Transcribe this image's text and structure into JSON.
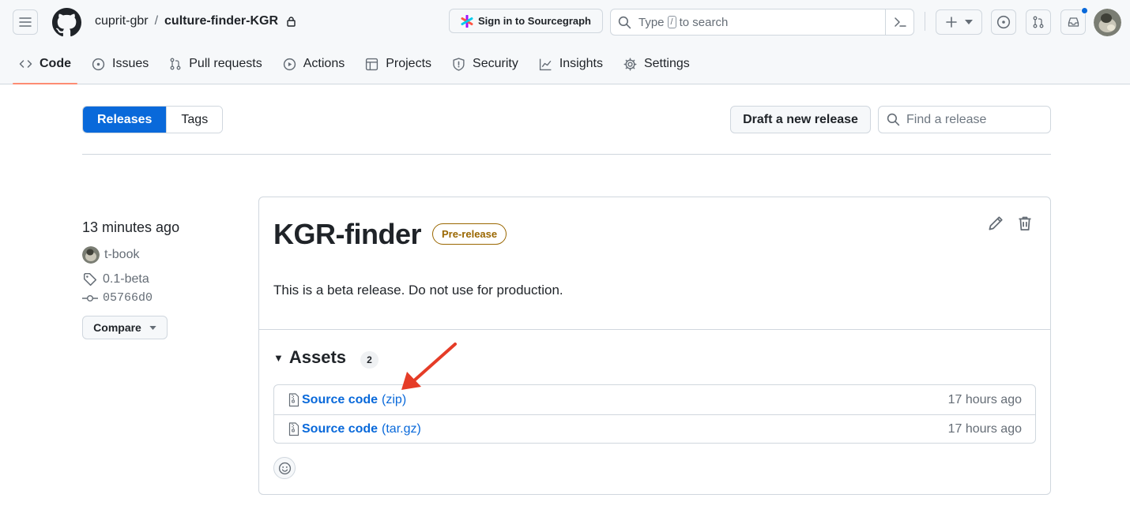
{
  "header": {
    "owner": "cuprit-gbr",
    "separator": "/",
    "repo": "culture-finder-KGR",
    "sourcegraph_label": "Sign in to Sourcegraph",
    "search_prefix": "Type",
    "search_key": "/",
    "search_suffix": "to search"
  },
  "tabs": [
    {
      "label": "Code",
      "icon": "code-icon"
    },
    {
      "label": "Issues",
      "icon": "issue-icon"
    },
    {
      "label": "Pull requests",
      "icon": "pull-request-icon"
    },
    {
      "label": "Actions",
      "icon": "play-icon"
    },
    {
      "label": "Projects",
      "icon": "table-icon"
    },
    {
      "label": "Security",
      "icon": "shield-icon"
    },
    {
      "label": "Insights",
      "icon": "graph-icon"
    },
    {
      "label": "Settings",
      "icon": "gear-icon"
    }
  ],
  "subnav": {
    "releases_label": "Releases",
    "tags_label": "Tags",
    "draft_label": "Draft a new release",
    "find_placeholder": "Find a release"
  },
  "release": {
    "time": "13 minutes ago",
    "author": "t-book",
    "tag": "0.1-beta",
    "commit": "05766d0",
    "compare_label": "Compare",
    "title": "KGR-finder",
    "badge": "Pre-release",
    "description": "This is a beta release. Do not use for production.",
    "assets_title": "Assets",
    "assets_count": "2",
    "assets": [
      {
        "name": "Source code",
        "ext": "(zip)",
        "time": "17 hours ago"
      },
      {
        "name": "Source code",
        "ext": "(tar.gz)",
        "time": "17 hours ago"
      }
    ]
  },
  "colors": {
    "accent": "#0969da",
    "tab_underline": "#fd8c73",
    "prerelease": "#9a6700",
    "annotation_arrow": "#e53c27"
  }
}
